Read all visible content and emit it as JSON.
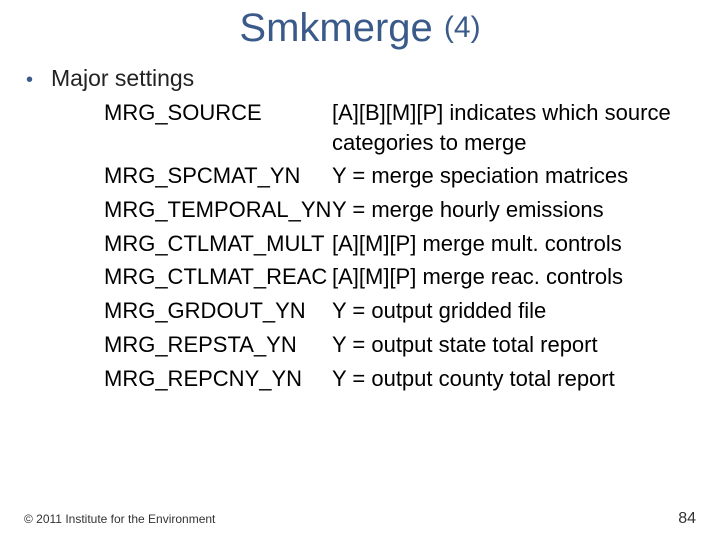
{
  "title_main": "Smkmerge ",
  "title_num": "(4)",
  "bullet_label": "Major settings",
  "settings": [
    {
      "name": "MRG_SOURCE",
      "desc": "[A][B][M][P] indicates which source categories to merge"
    },
    {
      "name": "MRG_SPCMAT_YN",
      "desc": "Y = merge speciation matrices"
    },
    {
      "name": "MRG_TEMPORAL_YN",
      "desc": "Y = merge hourly emissions"
    },
    {
      "name": "MRG_CTLMAT_MULT",
      "desc": "[A][M][P] merge mult. controls"
    },
    {
      "name": "MRG_CTLMAT_REAC",
      "desc": "[A][M][P] merge reac. controls"
    },
    {
      "name": "MRG_GRDOUT_YN",
      "desc": "Y = output gridded file"
    },
    {
      "name": "MRG_REPSTA_YN",
      "desc": "Y = output state total report"
    },
    {
      "name": "MRG_REPCNY_YN",
      "desc": "Y = output county total report"
    }
  ],
  "copyright": "© 2011 Institute for the Environment",
  "page_number": "84"
}
